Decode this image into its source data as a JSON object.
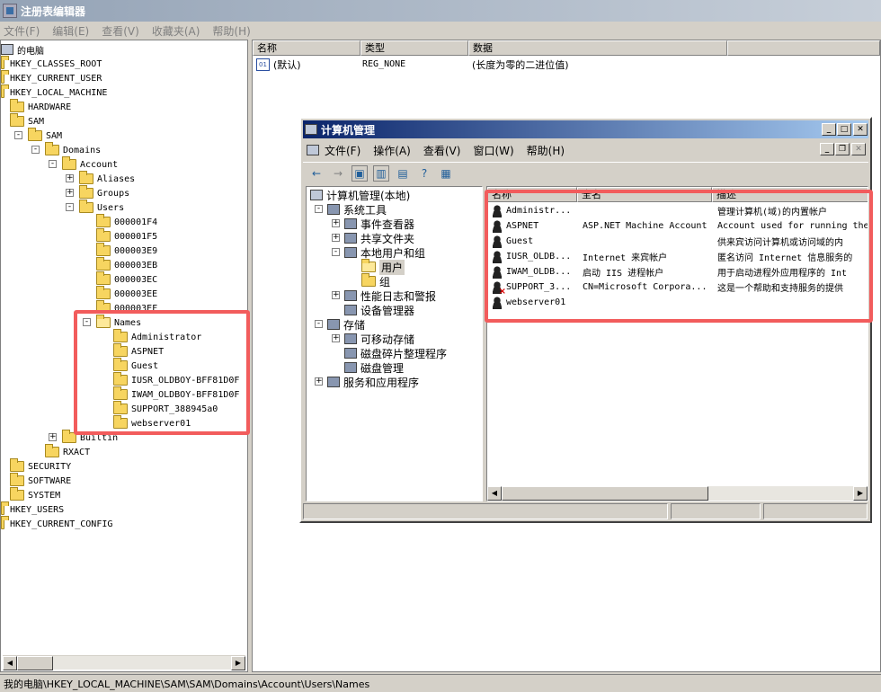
{
  "registry": {
    "title": "注册表编辑器",
    "menu": [
      "文件(F)",
      "编辑(E)",
      "查看(V)",
      "收藏夹(A)",
      "帮助(H)"
    ],
    "tree": [
      {
        "label": "的电脑",
        "depth": 0,
        "kind": "pc",
        "exp": ""
      },
      {
        "label": "HKEY_CLASSES_ROOT",
        "depth": 0,
        "kind": "folder",
        "exp": ""
      },
      {
        "label": "HKEY_CURRENT_USER",
        "depth": 0,
        "kind": "folder",
        "exp": ""
      },
      {
        "label": "HKEY_LOCAL_MACHINE",
        "depth": 0,
        "kind": "folder",
        "exp": ""
      },
      {
        "label": "HARDWARE",
        "depth": 1,
        "kind": "folder",
        "exp": ""
      },
      {
        "label": "SAM",
        "depth": 1,
        "kind": "folder",
        "exp": ""
      },
      {
        "label": "SAM",
        "depth": 2,
        "kind": "folder",
        "exp": "-"
      },
      {
        "label": "Domains",
        "depth": 3,
        "kind": "folder",
        "exp": "-"
      },
      {
        "label": "Account",
        "depth": 4,
        "kind": "folder",
        "exp": "-"
      },
      {
        "label": "Aliases",
        "depth": 5,
        "kind": "folder",
        "exp": "+"
      },
      {
        "label": "Groups",
        "depth": 5,
        "kind": "folder",
        "exp": "+"
      },
      {
        "label": "Users",
        "depth": 5,
        "kind": "folder",
        "exp": "-"
      },
      {
        "label": "000001F4",
        "depth": 6,
        "kind": "folder",
        "exp": ""
      },
      {
        "label": "000001F5",
        "depth": 6,
        "kind": "folder",
        "exp": ""
      },
      {
        "label": "000003E9",
        "depth": 6,
        "kind": "folder",
        "exp": ""
      },
      {
        "label": "000003EB",
        "depth": 6,
        "kind": "folder",
        "exp": ""
      },
      {
        "label": "000003EC",
        "depth": 6,
        "kind": "folder",
        "exp": ""
      },
      {
        "label": "000003EE",
        "depth": 6,
        "kind": "folder",
        "exp": ""
      },
      {
        "label": "000003EF",
        "depth": 6,
        "kind": "folder",
        "exp": ""
      },
      {
        "label": "Names",
        "depth": 6,
        "kind": "folder-open",
        "exp": "-"
      },
      {
        "label": "Administrator",
        "depth": 7,
        "kind": "folder",
        "exp": ""
      },
      {
        "label": "ASPNET",
        "depth": 7,
        "kind": "folder",
        "exp": ""
      },
      {
        "label": "Guest",
        "depth": 7,
        "kind": "folder",
        "exp": ""
      },
      {
        "label": "IUSR_OLDBOY-BFF81D0F",
        "depth": 7,
        "kind": "folder",
        "exp": ""
      },
      {
        "label": "IWAM_OLDBOY-BFF81D0F",
        "depth": 7,
        "kind": "folder",
        "exp": ""
      },
      {
        "label": "SUPPORT_388945a0",
        "depth": 7,
        "kind": "folder",
        "exp": ""
      },
      {
        "label": "webserver01",
        "depth": 7,
        "kind": "folder",
        "exp": ""
      },
      {
        "label": "Builtin",
        "depth": 4,
        "kind": "folder",
        "exp": "+"
      },
      {
        "label": "RXACT",
        "depth": 3,
        "kind": "folder",
        "exp": ""
      },
      {
        "label": "SECURITY",
        "depth": 1,
        "kind": "folder",
        "exp": ""
      },
      {
        "label": "SOFTWARE",
        "depth": 1,
        "kind": "folder",
        "exp": ""
      },
      {
        "label": "SYSTEM",
        "depth": 1,
        "kind": "folder",
        "exp": ""
      },
      {
        "label": "HKEY_USERS",
        "depth": 0,
        "kind": "folder",
        "exp": ""
      },
      {
        "label": "HKEY_CURRENT_CONFIG",
        "depth": 0,
        "kind": "folder",
        "exp": ""
      }
    ],
    "columns": [
      "名称",
      "类型",
      "数据"
    ],
    "values": [
      {
        "name": "(默认)",
        "type": "REG_NONE",
        "data": "(长度为零的二进位值)"
      }
    ],
    "status": "我的电脑\\HKEY_LOCAL_MACHINE\\SAM\\SAM\\Domains\\Account\\Users\\Names"
  },
  "cm": {
    "title": "计算机管理",
    "menu": [
      "文件(F)",
      "操作(A)",
      "查看(V)",
      "窗口(W)",
      "帮助(H)"
    ],
    "tree": [
      {
        "label": "计算机管理(本地)",
        "depth": 0,
        "exp": ""
      },
      {
        "label": "系统工具",
        "depth": 1,
        "exp": "-"
      },
      {
        "label": "事件查看器",
        "depth": 2,
        "exp": "+"
      },
      {
        "label": "共享文件夹",
        "depth": 2,
        "exp": "+"
      },
      {
        "label": "本地用户和组",
        "depth": 2,
        "exp": "-"
      },
      {
        "label": "用户",
        "depth": 3,
        "exp": "",
        "selected": true
      },
      {
        "label": "组",
        "depth": 3,
        "exp": ""
      },
      {
        "label": "性能日志和警报",
        "depth": 2,
        "exp": "+"
      },
      {
        "label": "设备管理器",
        "depth": 2,
        "exp": ""
      },
      {
        "label": "存储",
        "depth": 1,
        "exp": "-"
      },
      {
        "label": "可移动存储",
        "depth": 2,
        "exp": "+"
      },
      {
        "label": "磁盘碎片整理程序",
        "depth": 2,
        "exp": ""
      },
      {
        "label": "磁盘管理",
        "depth": 2,
        "exp": ""
      },
      {
        "label": "服务和应用程序",
        "depth": 1,
        "exp": "+"
      }
    ],
    "columns": [
      "名称",
      "全名",
      "描述"
    ],
    "users": [
      {
        "name": "Administr...",
        "full": "",
        "desc": "管理计算机(域)的内置帐户",
        "disabled": false
      },
      {
        "name": "ASPNET",
        "full": "ASP.NET Machine Account",
        "desc": "Account used for running the",
        "disabled": false
      },
      {
        "name": "Guest",
        "full": "",
        "desc": "供来宾访问计算机或访问域的内",
        "disabled": false
      },
      {
        "name": "IUSR_OLDB...",
        "full": "Internet 来宾帐户",
        "desc": "匿名访问 Internet 信息服务的",
        "disabled": false
      },
      {
        "name": "IWAM_OLDB...",
        "full": "启动 IIS 进程帐户",
        "desc": "用于启动进程外应用程序的 Int",
        "disabled": false
      },
      {
        "name": "SUPPORT_3...",
        "full": "CN=Microsoft Corpora...",
        "desc": "这是一个帮助和支持服务的提供",
        "disabled": true
      },
      {
        "name": "webserver01",
        "full": "",
        "desc": "",
        "disabled": false
      }
    ]
  }
}
